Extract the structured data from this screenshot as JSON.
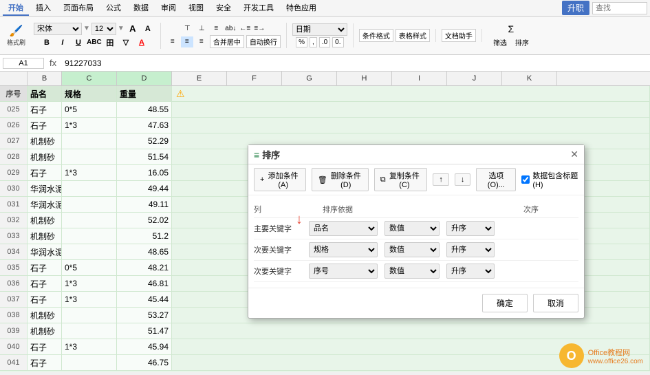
{
  "tabs": {
    "items": [
      "开始",
      "插入",
      "页面布局",
      "公式",
      "数据",
      "审阅",
      "视图",
      "安全",
      "开发工具",
      "特色应用"
    ],
    "active": 0,
    "search_placeholder": "查找"
  },
  "ribbon": {
    "upgrade_label": "升职",
    "format_brush": "格式刷",
    "font_name": "宋体",
    "font_size": "12",
    "bold": "B",
    "italic": "I",
    "underline": "U",
    "strikethrough": "S",
    "border": "田",
    "fill": "▽",
    "font_color": "A",
    "align_left": "≡",
    "align_center": "≡",
    "align_right": "≡",
    "merge_center": "合并居中",
    "auto_wrap": "自动换行",
    "number_format": "日期",
    "pct": "%",
    "comma": ",",
    "increase_decimal": ".0",
    "decrease_decimal": "0.",
    "cond_format": "条件格式",
    "table_style": "表格样式",
    "text_assist": "文档助手",
    "sum": "Σ",
    "filter_label": "筛选",
    "sort_label": "排序"
  },
  "formula_bar": {
    "cell_ref": "A1",
    "formula_value": "91227033"
  },
  "columns": {
    "headers": [
      "B",
      "C",
      "D",
      "E",
      "F",
      "G",
      "H",
      "I",
      "J",
      "K"
    ],
    "widths": [
      50,
      80,
      80,
      80,
      80,
      80,
      80,
      80,
      80,
      80
    ],
    "sub_headers": [
      "序号",
      "品名",
      "规格",
      "重量"
    ]
  },
  "rows": [
    {
      "num": "025",
      "b": "石子",
      "c": "0*5",
      "d": "48.55"
    },
    {
      "num": "026",
      "b": "石子",
      "c": "1*3",
      "d": "47.63"
    },
    {
      "num": "027",
      "b": "机制砂",
      "c": "",
      "d": "52.29"
    },
    {
      "num": "028",
      "b": "机制砂",
      "c": "",
      "d": "51.54"
    },
    {
      "num": "029",
      "b": "石子",
      "c": "1*3",
      "d": "16.05"
    },
    {
      "num": "030",
      "b": "华润水泥",
      "c": "",
      "d": "49.44"
    },
    {
      "num": "031",
      "b": "华润水泥",
      "c": "",
      "d": "49.11"
    },
    {
      "num": "032",
      "b": "机制砂",
      "c": "",
      "d": "52.02"
    },
    {
      "num": "033",
      "b": "机制砂",
      "c": "",
      "d": "51.2"
    },
    {
      "num": "034",
      "b": "华润水泥",
      "c": "",
      "d": "48.65"
    },
    {
      "num": "035",
      "b": "石子",
      "c": "0*5",
      "d": "48.21"
    },
    {
      "num": "036",
      "b": "石子",
      "c": "1*3",
      "d": "46.81"
    },
    {
      "num": "037",
      "b": "石子",
      "c": "1*3",
      "d": "45.44"
    },
    {
      "num": "038",
      "b": "机制砂",
      "c": "",
      "d": "53.27"
    },
    {
      "num": "039",
      "b": "机制砂",
      "c": "",
      "d": "51.47"
    },
    {
      "num": "040",
      "b": "石子",
      "c": "1*3",
      "d": "45.94"
    },
    {
      "num": "041",
      "b": "石子",
      "c": "",
      "d": "46.75"
    }
  ],
  "sort_dialog": {
    "title": "排序",
    "add_condition": "添加条件(A)",
    "delete_condition": "删除条件(D)",
    "copy_condition": "复制条件(C)",
    "options": "选项(O)...",
    "data_has_header": "数据包含标题(H)",
    "col_header": "列",
    "basis_header": "排序依据",
    "order_header": "次序",
    "rows": [
      {
        "label": "主要关键字",
        "col": "品名",
        "basis": "数值",
        "order": "升序"
      },
      {
        "label": "次要关键字",
        "col": "规格",
        "basis": "数值",
        "order": "升序"
      },
      {
        "label": "次要关键字",
        "col": "序号",
        "basis": "数值",
        "order": "升序"
      }
    ],
    "ok": "确定",
    "cancel": "取消"
  },
  "watermark": {
    "site": "Office教程网",
    "url": "www.office26.com"
  }
}
